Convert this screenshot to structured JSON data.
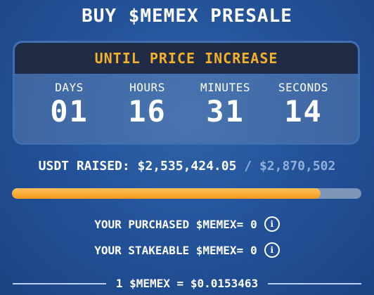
{
  "title": "BUY $MEMEX PRESALE",
  "countdown": {
    "header": "UNTIL PRICE INCREASE",
    "units": [
      {
        "label": "DAYS",
        "value": "01"
      },
      {
        "label": "HOURS",
        "value": "16"
      },
      {
        "label": "MINUTES",
        "value": "31"
      },
      {
        "label": "SECONDS",
        "value": "14"
      }
    ]
  },
  "raised": {
    "label": "USDT RAISED:",
    "amount": "$2,535,424.05",
    "separator": "/",
    "target": "$2,870,502",
    "progress_fraction": 0.883
  },
  "purchased": {
    "label": "YOUR PURCHASED $MEMEX=",
    "value": "0",
    "icon": "info-icon"
  },
  "stakeable": {
    "label": "YOUR STAKEABLE $MEMEX=",
    "value": "0",
    "icon": "info-icon"
  },
  "price": {
    "text": "1 $MEMEX = $0.0153463"
  },
  "colors": {
    "accent": "#f3b02a",
    "progress": "#f39a1e",
    "background": "#24539a"
  }
}
